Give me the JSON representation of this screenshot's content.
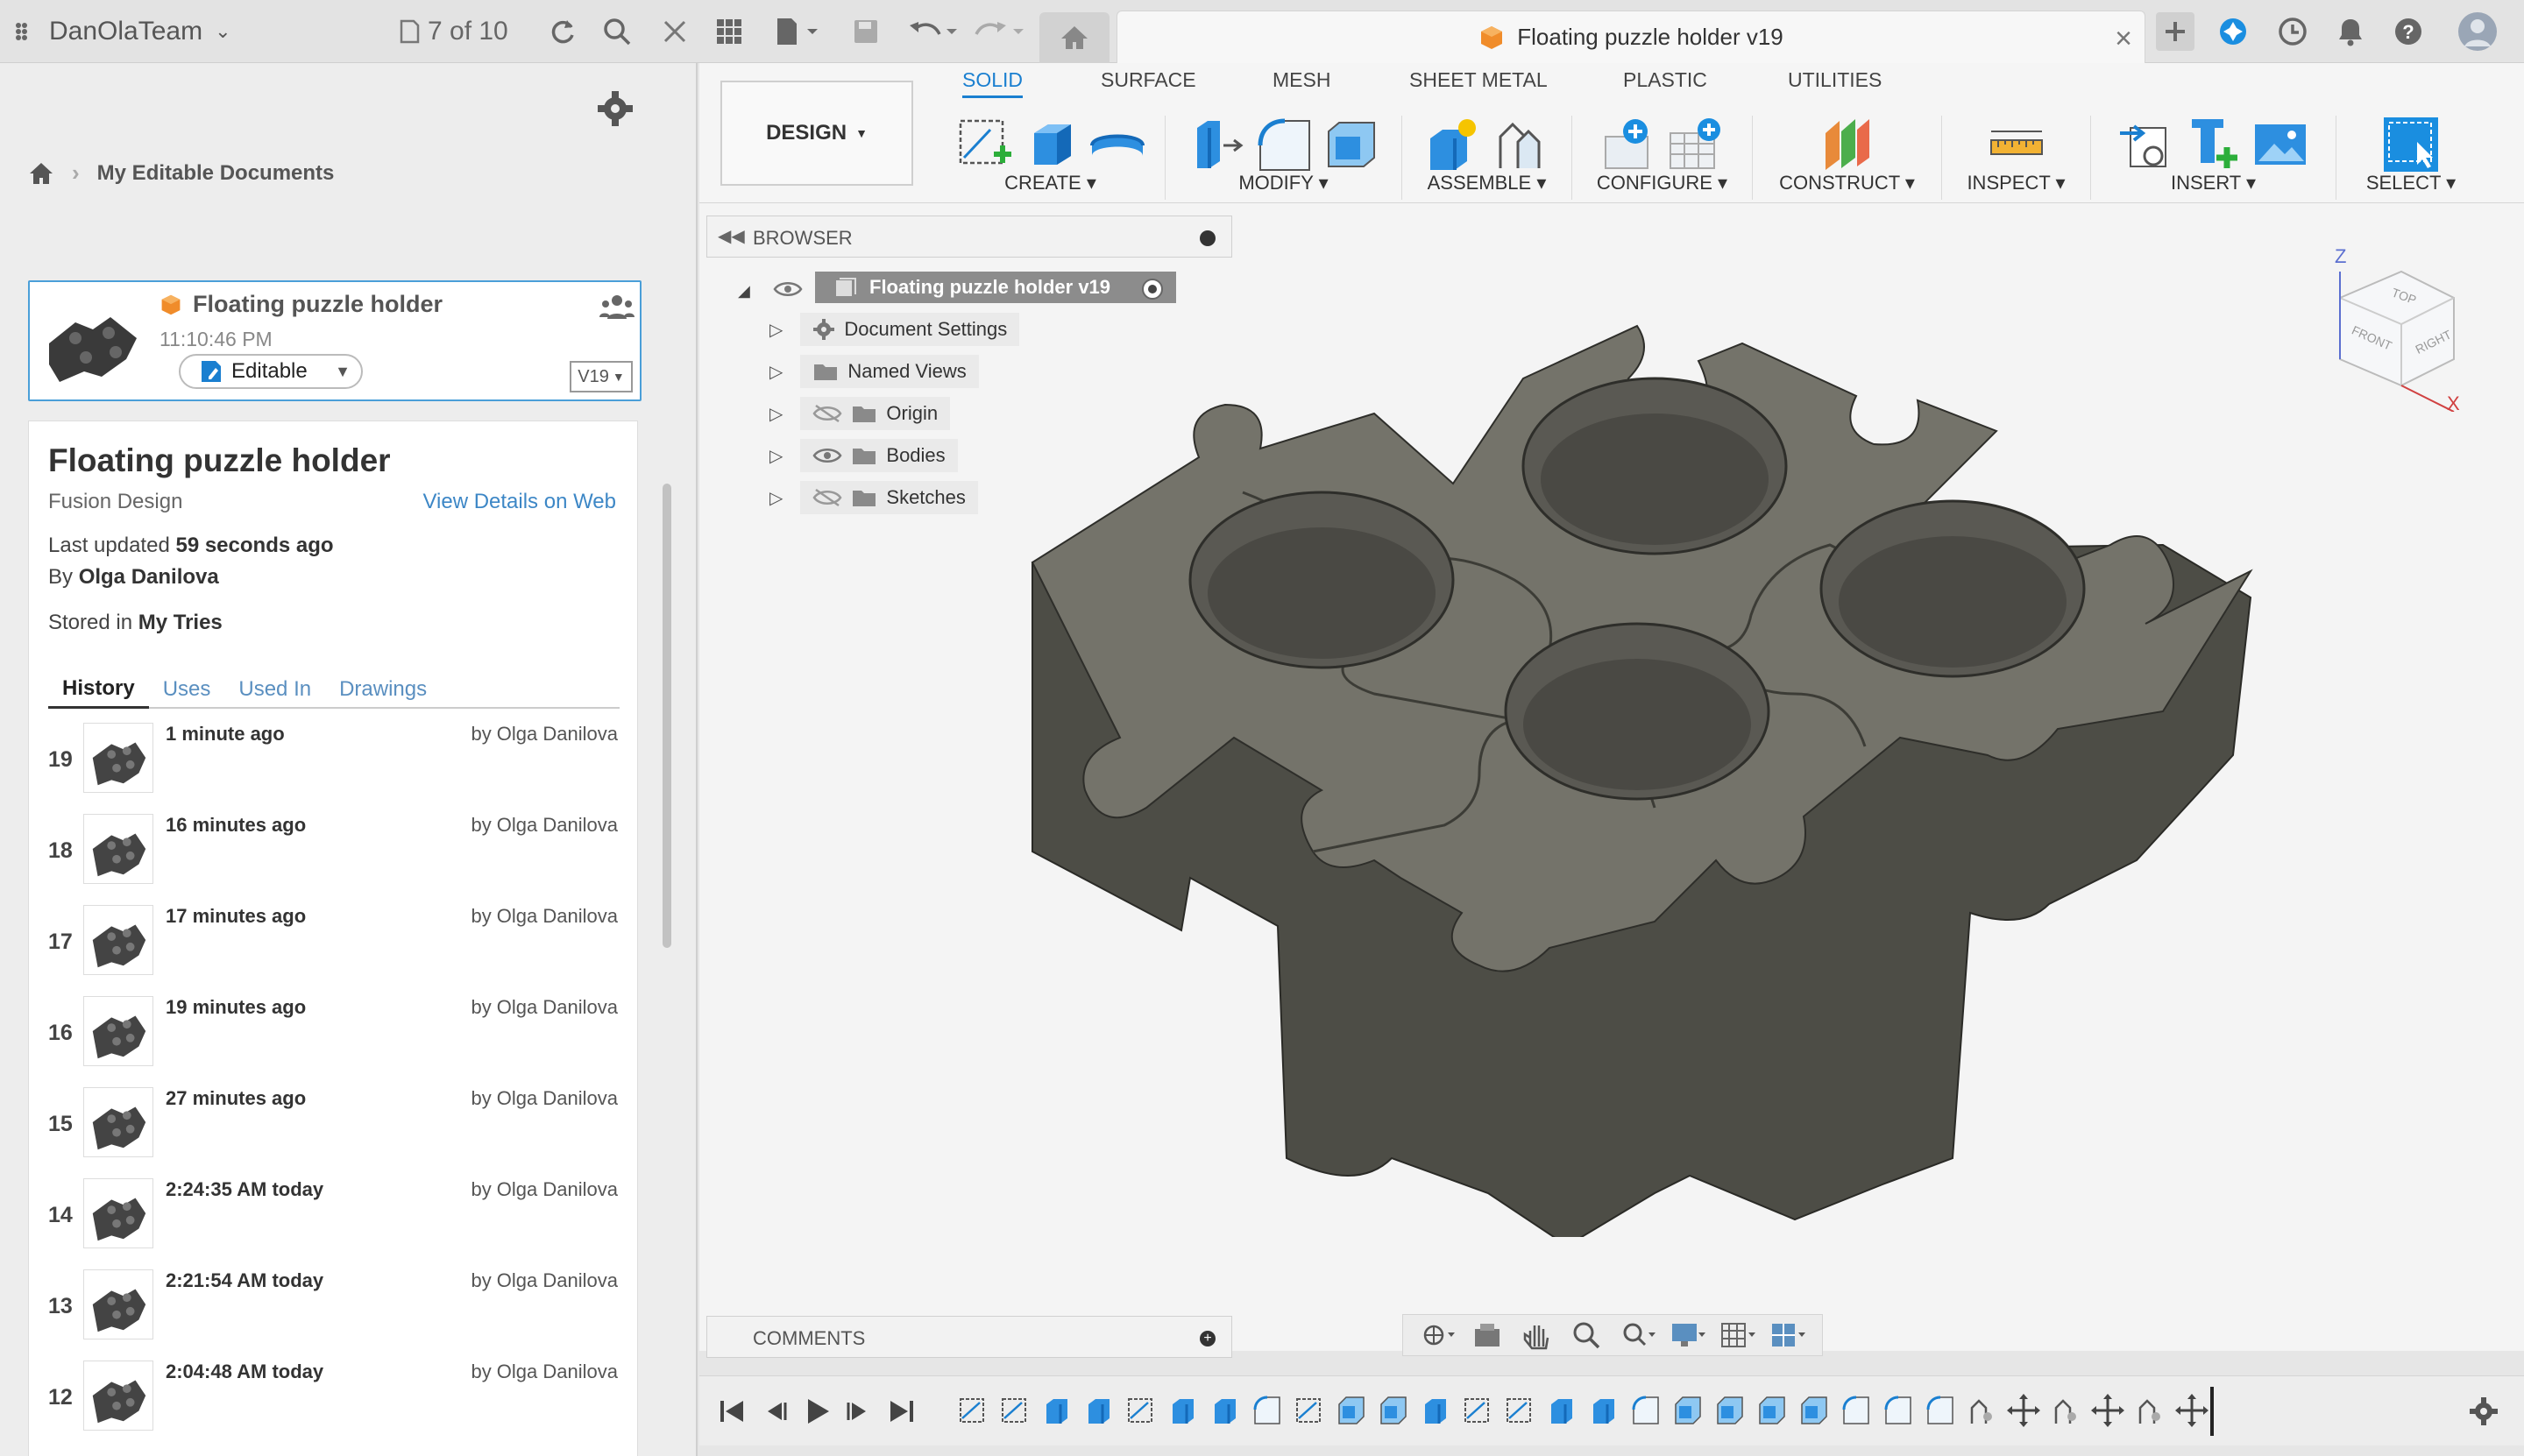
{
  "topbar": {
    "team": "DanOlaTeam",
    "counter": "7 of 10",
    "doc_tab_title": "Floating puzzle holder v19"
  },
  "left": {
    "breadcrumb": "My Editable Documents",
    "card": {
      "name": "Floating puzzle holder",
      "time": "11:10:46 PM",
      "status": "Editable",
      "version": "V19"
    },
    "details": {
      "title": "Floating puzzle holder",
      "type": "Fusion Design",
      "web_link": "View Details on Web",
      "updated_label": "Last updated",
      "updated_value": "59 seconds ago",
      "by_label": "By",
      "by_value": "Olga Danilova",
      "stored_label": "Stored in",
      "stored_value": "My Tries"
    },
    "tabs": [
      "History",
      "Uses",
      "Used In",
      "Drawings"
    ],
    "history": [
      {
        "num": "19",
        "time": "1 minute ago",
        "by": "by Olga Danilova"
      },
      {
        "num": "18",
        "time": "16 minutes ago",
        "by": "by Olga Danilova"
      },
      {
        "num": "17",
        "time": "17 minutes ago",
        "by": "by Olga Danilova"
      },
      {
        "num": "16",
        "time": "19 minutes ago",
        "by": "by Olga Danilova"
      },
      {
        "num": "15",
        "time": "27 minutes ago",
        "by": "by Olga Danilova"
      },
      {
        "num": "14",
        "time": "2:24:35 AM today",
        "by": "by Olga Danilova"
      },
      {
        "num": "13",
        "time": "2:21:54 AM today",
        "by": "by Olga Danilova"
      },
      {
        "num": "12",
        "time": "2:04:48 AM today",
        "by": "by Olga Danilova"
      }
    ]
  },
  "ribbon": {
    "workspace": "DESIGN",
    "tabs": [
      "SOLID",
      "SURFACE",
      "MESH",
      "SHEET METAL",
      "PLASTIC",
      "UTILITIES"
    ],
    "groups": [
      "CREATE",
      "MODIFY",
      "ASSEMBLE",
      "CONFIGURE",
      "CONSTRUCT",
      "INSPECT",
      "INSERT",
      "SELECT"
    ]
  },
  "browser": {
    "label": "BROWSER",
    "root": "Floating puzzle holder v19",
    "items": [
      "Document Settings",
      "Named Views",
      "Origin",
      "Bodies",
      "Sketches"
    ]
  },
  "viewcube": {
    "top": "TOP",
    "front": "FRONT",
    "right": "RIGHT",
    "z": "Z",
    "x": "X"
  },
  "comments": {
    "label": "COMMENTS"
  },
  "colors": {
    "accent": "#1a7fd0",
    "model": "#6b6a60",
    "model_top": "#74736a"
  }
}
